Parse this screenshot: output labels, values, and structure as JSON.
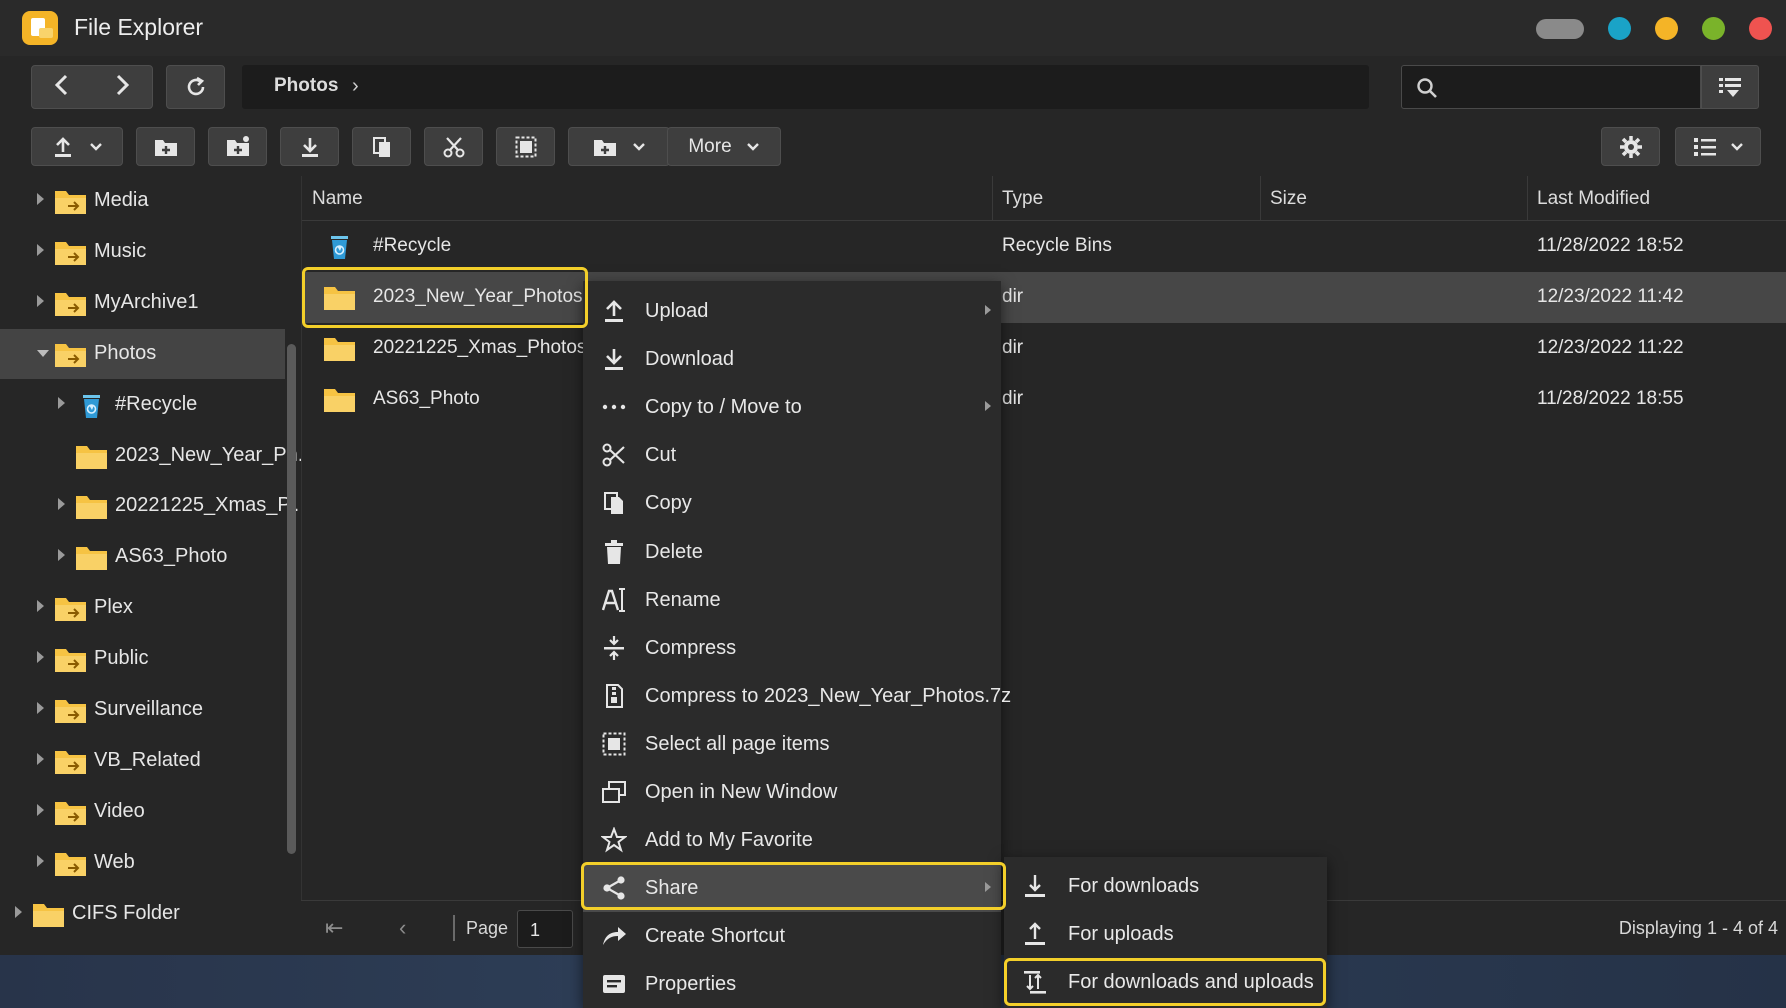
{
  "app": {
    "title": "File Explorer"
  },
  "window_controls": {
    "colors": [
      "#8a8a8a",
      "#1aa3c7",
      "#f4b427",
      "#7ab32a",
      "#ef5350"
    ]
  },
  "path": {
    "segment": "Photos"
  },
  "toolbar": {
    "more_label": "More"
  },
  "tree": [
    {
      "label": "Media",
      "level": 1,
      "expanded": false,
      "icon": "shared-folder-icon"
    },
    {
      "label": "Music",
      "level": 1,
      "expanded": false,
      "icon": "shared-folder-icon"
    },
    {
      "label": "MyArchive1",
      "level": 1,
      "expanded": false,
      "icon": "shared-folder-icon"
    },
    {
      "label": "Photos",
      "level": 1,
      "expanded": true,
      "selected": true,
      "icon": "shared-folder-icon"
    },
    {
      "label": "#Recycle",
      "level": 2,
      "expanded": false,
      "icon": "recycle-bin-icon"
    },
    {
      "label": "2023_New_Year_Ph..",
      "level": 2,
      "noarrow": true,
      "icon": "folder-icon"
    },
    {
      "label": "20221225_Xmas_P..",
      "level": 2,
      "expanded": false,
      "icon": "folder-icon"
    },
    {
      "label": "AS63_Photo",
      "level": 2,
      "expanded": false,
      "icon": "folder-icon"
    },
    {
      "label": "Plex",
      "level": 1,
      "expanded": false,
      "icon": "shared-folder-icon"
    },
    {
      "label": "Public",
      "level": 1,
      "expanded": false,
      "icon": "shared-folder-icon"
    },
    {
      "label": "Surveillance",
      "level": 1,
      "expanded": false,
      "icon": "shared-folder-icon"
    },
    {
      "label": "VB_Related",
      "level": 1,
      "expanded": false,
      "icon": "shared-folder-icon"
    },
    {
      "label": "Video",
      "level": 1,
      "expanded": false,
      "icon": "shared-folder-icon"
    },
    {
      "label": "Web",
      "level": 1,
      "expanded": false,
      "icon": "shared-folder-icon"
    },
    {
      "label": "CIFS Folder",
      "level": 0,
      "expanded": false,
      "icon": "folder-icon"
    }
  ],
  "list": {
    "columns": [
      "Name",
      "Type",
      "Size",
      "Last Modified"
    ],
    "rows": [
      {
        "name": "#Recycle",
        "type": "Recycle Bins",
        "size": "",
        "modified": "11/28/2022 18:52",
        "icon": "recycle-bin-icon"
      },
      {
        "name": "2023_New_Year_Photos",
        "type": "dir",
        "size": "",
        "modified": "12/23/2022 11:42",
        "icon": "folder-icon",
        "selected": true
      },
      {
        "name": "20221225_Xmas_Photos",
        "type": "dir",
        "size": "",
        "modified": "12/23/2022 11:22",
        "icon": "folder-icon"
      },
      {
        "name": "AS63_Photo",
        "type": "dir",
        "size": "",
        "modified": "11/28/2022 18:55",
        "icon": "folder-icon"
      }
    ]
  },
  "pager": {
    "page_label": "Page",
    "page_value": "1",
    "display": "Displaying 1 - 4 of 4"
  },
  "context_menu": [
    {
      "label": "Upload",
      "icon": "upload-icon",
      "submenu": true
    },
    {
      "label": "Download",
      "icon": "download-icon"
    },
    {
      "label": "Copy to / Move to",
      "icon": "more-dots-icon",
      "submenu": true
    },
    {
      "label": "Cut",
      "icon": "scissors-icon"
    },
    {
      "label": "Copy",
      "icon": "copy-icon"
    },
    {
      "label": "Delete",
      "icon": "trash-icon"
    },
    {
      "label": "Rename",
      "icon": "rename-icon"
    },
    {
      "label": "Compress",
      "icon": "compress-icon"
    },
    {
      "label": "Compress to 2023_New_Year_Photos.7z",
      "icon": "archive-icon"
    },
    {
      "label": "Select all page items",
      "icon": "select-all-icon"
    },
    {
      "label": "Open in New Window",
      "icon": "new-window-icon"
    },
    {
      "label": "Add to My Favorite",
      "icon": "star-icon"
    },
    {
      "label": "Share",
      "icon": "share-icon",
      "submenu": true,
      "highlighted": true
    },
    {
      "label": "Create Shortcut",
      "icon": "shortcut-icon"
    },
    {
      "label": "Properties",
      "icon": "properties-icon"
    }
  ],
  "share_submenu": [
    {
      "label": "For downloads",
      "icon": "share-download-icon"
    },
    {
      "label": "For uploads",
      "icon": "share-upload-icon"
    },
    {
      "label": "For downloads and uploads",
      "icon": "share-both-icon"
    }
  ],
  "accent": {
    "outline": "#f3cf2a",
    "folder": "#f6c343"
  }
}
